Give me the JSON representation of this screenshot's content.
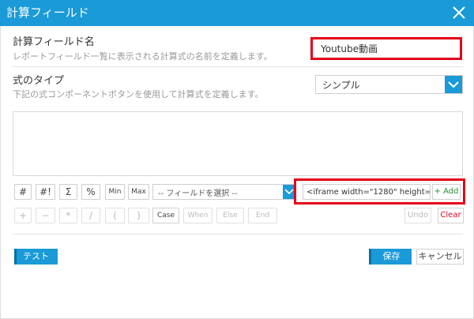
{
  "dialog": {
    "title": "計算フィールド",
    "close_icon": "close-icon"
  },
  "calc_field_name": {
    "label": "計算フィールド名",
    "description": "レポートフィールド一覧に表示される計算式の名前を定義します。",
    "value": "Youtube動画"
  },
  "formula_type": {
    "label": "式のタイプ",
    "description": "下記の式コンポーネントボタンを使用して計算式を定義します。",
    "selected": "シンプル",
    "dropdown_icon": "chevron-down-icon"
  },
  "editor": {
    "content": ""
  },
  "toolbar_row1": {
    "buttons": [
      "#",
      "#!",
      "Σ",
      "%",
      "Min",
      "Max"
    ],
    "field_select": "-- フィールドを選択 --",
    "code_value": "<iframe width=\"1280\" height=",
    "add_label": "+ Add"
  },
  "toolbar_row2": {
    "buttons": [
      "+",
      "−",
      "*",
      "/",
      "(",
      ")",
      "Case",
      "When",
      "Else",
      "End"
    ],
    "undo_label": "Undo",
    "clear_label": "Clear"
  },
  "footer": {
    "test_label": "テスト",
    "save_label": "保存",
    "cancel_label": "キャンセル"
  },
  "colors": {
    "accent": "#1a9ad7",
    "highlight": "#e3001b",
    "add_green": "#2e8b3a"
  }
}
